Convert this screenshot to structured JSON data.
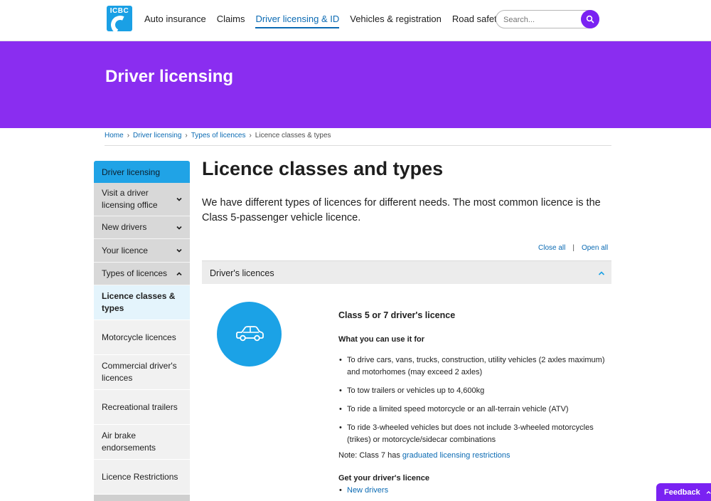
{
  "header": {
    "logo_text": "ICBC",
    "nav": [
      {
        "label": "Auto insurance",
        "active": false
      },
      {
        "label": "Claims",
        "active": false
      },
      {
        "label": "Driver licensing & ID",
        "active": true
      },
      {
        "label": "Vehicles & registration",
        "active": false
      },
      {
        "label": "Road safety",
        "active": false
      }
    ],
    "search": {
      "placeholder": "Search..."
    }
  },
  "banner": {
    "title": "Driver licensing"
  },
  "breadcrumb": [
    {
      "label": "Home",
      "link": true
    },
    {
      "label": "Driver licensing",
      "link": true
    },
    {
      "label": "Types of licences",
      "link": true
    },
    {
      "label": "Licence classes & types",
      "link": false
    }
  ],
  "sidebar": {
    "heading": "Driver licensing",
    "items": [
      {
        "label": "Visit a driver licensing office",
        "expanded": false
      },
      {
        "label": "New drivers",
        "expanded": false
      },
      {
        "label": "Your licence",
        "expanded": false
      },
      {
        "label": "Types of licences",
        "expanded": true
      }
    ],
    "subitems": [
      {
        "label": "Licence classes & types",
        "current": true
      },
      {
        "label": "Motorcycle licences",
        "current": false
      },
      {
        "label": "Commercial driver's licences",
        "current": false
      },
      {
        "label": "Recreational trailers",
        "current": false
      },
      {
        "label": "Air brake endorsements",
        "current": false
      },
      {
        "label": "Licence Restrictions",
        "current": false
      }
    ]
  },
  "main": {
    "title": "Licence classes and types",
    "intro": "We have different types of licences for different needs. The most common licence is the Class 5-passenger vehicle licence.",
    "close_all": "Close all",
    "divider": "|",
    "open_all": "Open all",
    "accordion_title": "Driver's licences",
    "section": {
      "heading": "Class 5 or 7 driver's licence",
      "use_heading": "What you can use it for",
      "uses": [
        "To drive cars, vans, trucks, construction, utility vehicles (2 axles maximum) and motorhomes (may exceed 2 axles)",
        "To tow trailers or vehicles up to 4,600kg",
        "To ride a limited speed motorcycle or an all-terrain vehicle (ATV)",
        "To ride 3-wheeled vehicles but does not include 3-wheeled motorcycles (trikes) or motorcycle/sidecar combinations"
      ],
      "note_prefix": "Note: Class 7 has ",
      "note_link": "graduated licensing restrictions",
      "get_heading": "Get your driver's licence",
      "get_links": [
        "New drivers"
      ]
    }
  },
  "feedback": {
    "label": "Feedback"
  },
  "colors": {
    "brand_purple": "#8a2df0",
    "accent_blue": "#1ba2e6",
    "link_blue": "#0a6ab3"
  }
}
